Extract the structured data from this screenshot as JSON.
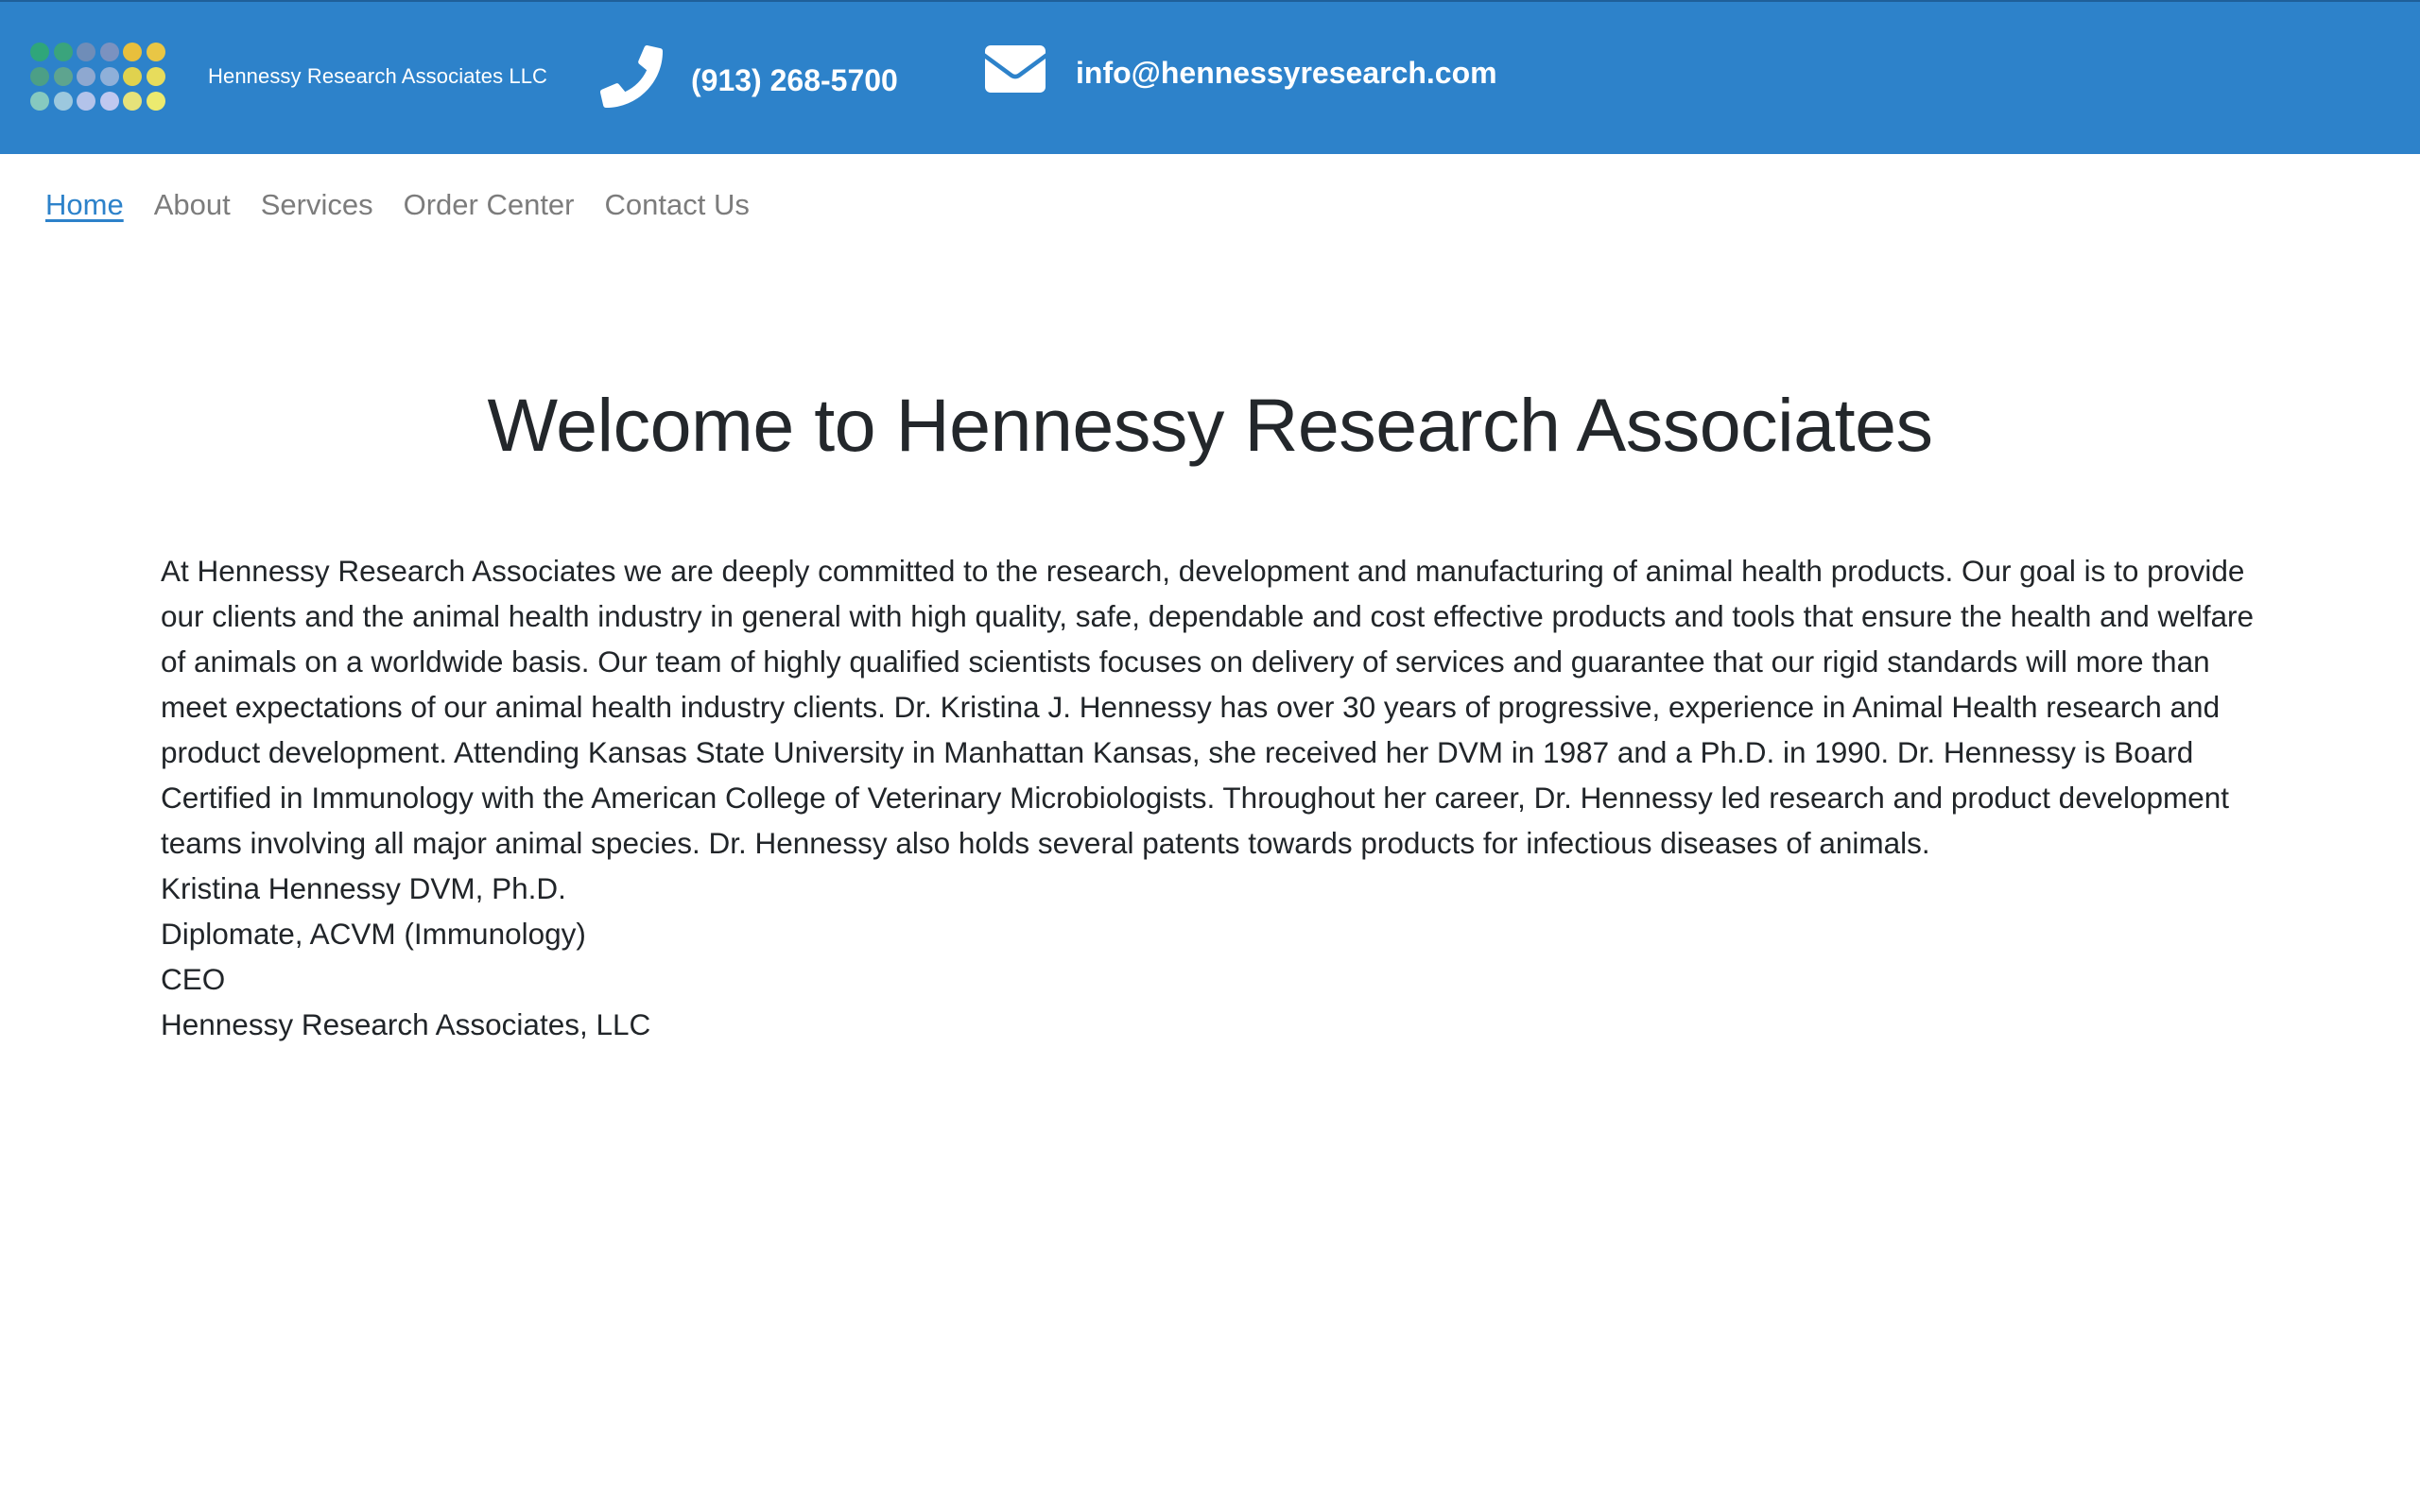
{
  "header": {
    "logo_text": "Hennessy Research Associates LLC",
    "logo_dot_colors": [
      "#2fa67a",
      "#3aa47c",
      "#6f8db8",
      "#7b92c0",
      "#e8bf3c",
      "#e9c645",
      "#4c9f86",
      "#5ea48f",
      "#8ea8d0",
      "#8fb0d9",
      "#e0d24e",
      "#e7dc5c",
      "#86c9bf",
      "#9cc8de",
      "#b3c3ea",
      "#c0c8ef",
      "#e6e27a",
      "#ecea6f"
    ],
    "phone": "(913) 268-5700",
    "email": "info@hennessyresearch.com",
    "icons": {
      "phone": "phone-icon",
      "email": "envelope-icon"
    }
  },
  "nav": {
    "items": [
      {
        "label": "Home",
        "active": true
      },
      {
        "label": "About",
        "active": false
      },
      {
        "label": "Services",
        "active": false
      },
      {
        "label": "Order Center",
        "active": false
      },
      {
        "label": "Contact Us",
        "active": false
      }
    ]
  },
  "main": {
    "title": "Welcome to Hennessy Research Associates",
    "intro": "At Hennessy Research Associates we are deeply committed to the research, development and manufacturing of animal health products. Our goal is to provide our clients and the animal health industry in general with high quality, safe, dependable and cost effective products and tools that ensure the health and welfare of animals on a worldwide basis. Our team of highly qualified scientists focuses on delivery of services and guarantee that our rigid standards will more than meet expectations of our animal health industry clients. Dr. Kristina J. Hennessy has over 30 years of progressive, experience in Animal Health research and product development. Attending Kansas State University in Manhattan Kansas, she received her DVM in 1987 and a Ph.D. in 1990. Dr. Hennessy is Board Certified in Immunology with the American College of Veterinary Microbiologists. Throughout her career, Dr. Hennessy led research and product development teams involving all major animal species. Dr. Hennessy also holds several patents towards products for infectious diseases of animals.",
    "signature": {
      "name": "Kristina Hennessy DVM, Ph.D.",
      "credential": "Diplomate, ACVM (Immunology)",
      "role": "CEO",
      "company": "Hennessy Research Associates, LLC"
    }
  },
  "colors": {
    "header_bg": "#2d82ca",
    "nav_active": "#2d82ca",
    "nav_inactive": "#7c7c7c",
    "text": "#212529"
  }
}
